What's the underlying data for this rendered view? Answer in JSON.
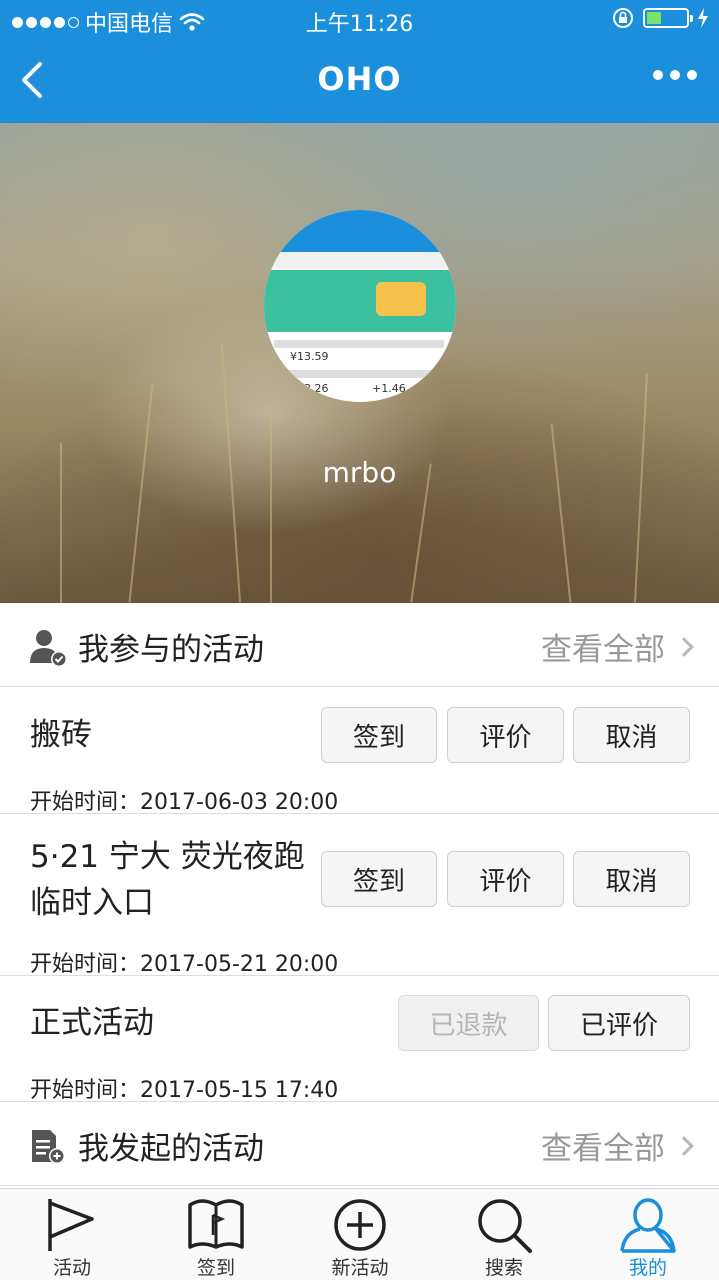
{
  "status_bar": {
    "carrier": "中国电信",
    "time": "上午11:26"
  },
  "nav": {
    "title": "OHO",
    "back_icon": "chevron-left-icon",
    "more_icon": "more-dots-icon"
  },
  "profile": {
    "username": "mrbo",
    "avatar_text_1": "¥13.59",
    "avatar_text_2": "3.26",
    "avatar_text_3": "+1.46"
  },
  "joined": {
    "title": "我参与的活动",
    "view_all": "查看全部",
    "items": [
      {
        "name": "搬砖",
        "time_label": "开始时间：",
        "time": "2017-06-03 20:00",
        "buttons": [
          "签到",
          "评价",
          "取消"
        ]
      },
      {
        "name_line1": "5·21 宁大 荧光夜跑",
        "name_line2": "临时入口",
        "time_label": "开始时间：",
        "time": "2017-05-21 20:00",
        "buttons": [
          "签到",
          "评价",
          "取消"
        ]
      },
      {
        "name": "正式活动",
        "time_label": "开始时间：",
        "time": "2017-05-15 17:40",
        "buttons": [
          "已退款",
          "已评价"
        ]
      }
    ]
  },
  "launched": {
    "title": "我发起的活动",
    "view_all": "查看全部"
  },
  "tabbar": {
    "tabs": [
      {
        "label": "活动",
        "icon": "flag-icon"
      },
      {
        "label": "签到",
        "icon": "book-icon"
      },
      {
        "label": "新活动",
        "icon": "plus-circle-icon"
      },
      {
        "label": "搜索",
        "icon": "search-icon"
      },
      {
        "label": "我的",
        "icon": "user-icon"
      }
    ],
    "active_index": 4,
    "active_color": "#1b8fdb"
  },
  "colors": {
    "brand": "#1b8fdb",
    "battery": "#7be36b"
  }
}
